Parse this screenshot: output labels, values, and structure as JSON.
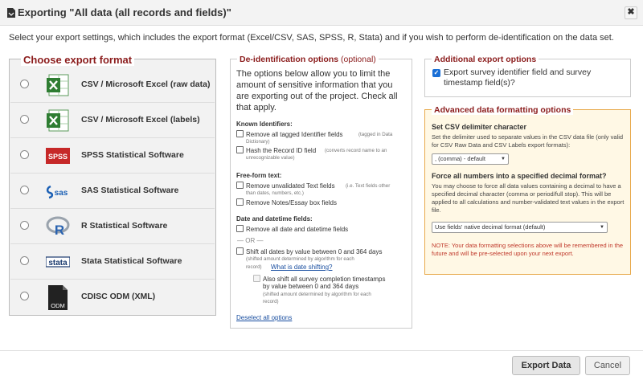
{
  "dialog": {
    "title": "Exporting \"All data (all records and fields)\"",
    "close_label": "✖",
    "intro": "Select your export settings, which includes the export format (Excel/CSV, SAS, SPSS, R, Stata) and if you wish to perform de-identification on the data set."
  },
  "formats": {
    "heading": "Choose export format",
    "items": [
      {
        "label": "CSV / Microsoft Excel (raw data)",
        "icon": "excel-icon"
      },
      {
        "label": "CSV / Microsoft Excel (labels)",
        "icon": "excel-icon"
      },
      {
        "label": "SPSS Statistical Software",
        "icon": "spss-icon",
        "icon_text": "SPSS"
      },
      {
        "label": "SAS Statistical Software",
        "icon": "sas-icon",
        "icon_text": "sas"
      },
      {
        "label": "R Statistical Software",
        "icon": "r-icon",
        "icon_text": "R"
      },
      {
        "label": "Stata Statistical Software",
        "icon": "stata-icon",
        "icon_text": "stata"
      },
      {
        "label": "CDISC ODM (XML)",
        "icon": "odm-icon",
        "icon_text": "ODM"
      }
    ]
  },
  "deid": {
    "heading": "De-identification options",
    "heading_optional": "(optional)",
    "intro": "The options below allow you to limit the amount of sensitive information that you are exporting out of the project. Check all that apply.",
    "known_heading": "Known Identifiers:",
    "known_opt1": "Remove all tagged Identifier fields",
    "known_opt1_note_a": "(tagged in Data",
    "known_opt1_note_b": "Dictionary)",
    "known_opt2": "Hash the Record ID field",
    "known_opt2_note_a": "(converts record name to an",
    "known_opt2_note_b": "unrecognizable value)",
    "free_heading": "Free-form text:",
    "free_opt1": "Remove unvalidated Text fields",
    "free_opt1_note_a": "(i.e. Text fields other",
    "free_opt1_note_b": "than dates, numbers, etc.)",
    "free_opt2": "Remove Notes/Essay box fields",
    "date_heading": "Date and datetime fields:",
    "date_opt1": "Remove all date and datetime fields",
    "or_text": "— OR —",
    "date_opt2": "Shift all dates by value between 0 and 364 days",
    "date_opt2_note_a": "(shifted amount determined by algorithm for each",
    "date_opt2_note_b": "record)",
    "date_shift_link": "What is date shifting?",
    "date_opt3_a": "Also shift all survey completion timestamps",
    "date_opt3_b": "by value between 0 and 364 days",
    "date_opt3_note_a": "(shifted amount determined by algorithm for each",
    "date_opt3_note_b": "record)",
    "deselect_link": "Deselect all options"
  },
  "additional": {
    "heading": "Additional export options",
    "checkbox_label": "Export survey identifier field and survey timestamp field(s)?",
    "checked": true
  },
  "advanced": {
    "heading": "Advanced data formatting options",
    "delim_heading": "Set CSV delimiter character",
    "delim_desc": "Set the delimiter used to separate values in the CSV data file (only valid for CSV Raw Data and CSV Labels export formats):",
    "delim_value": ", (comma) - default",
    "decimal_heading": "Force all numbers into a specified decimal format?",
    "decimal_desc": "You may choose to force all data values containing a decimal to have a specified decimal character (comma or period/full stop). This will be applied to all calculations and number-validated text values in the export file.",
    "decimal_value": "Use fields' native decimal format (default)",
    "note": "NOTE: Your data formatting selections above will be remembered in the future and will be pre-selected upon your next export.",
    "note_color": "#c0392b"
  },
  "footer": {
    "export_label": "Export Data",
    "cancel_label": "Cancel"
  }
}
